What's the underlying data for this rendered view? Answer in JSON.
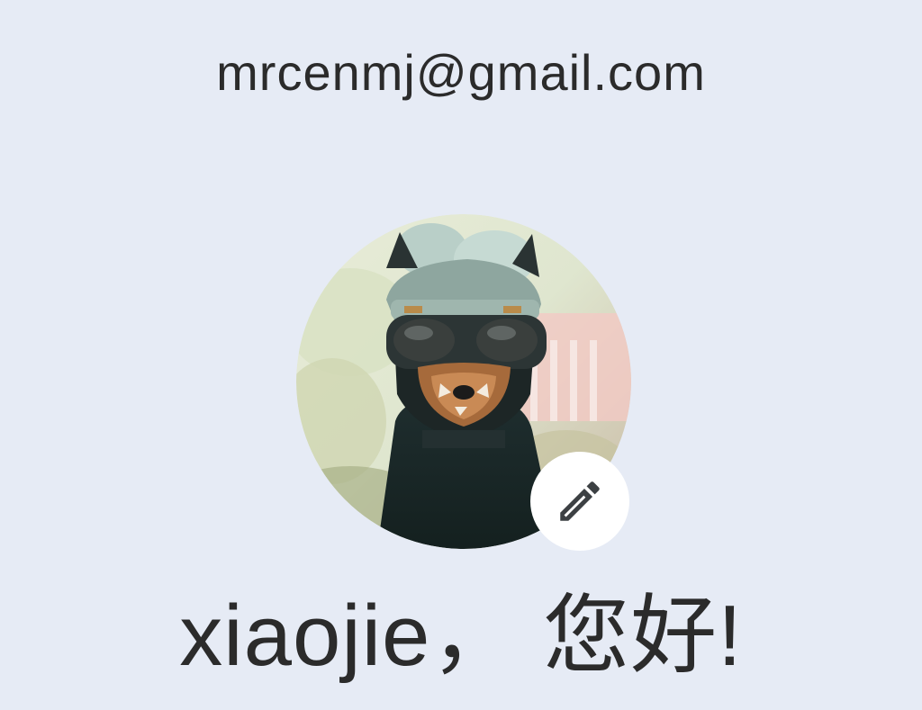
{
  "account": {
    "email": "mrcenmj@gmail.com",
    "greeting": "xiaojie，  您好!"
  },
  "avatar": {
    "icon": "avatar"
  },
  "edit": {
    "icon": "pencil-icon"
  },
  "colors": {
    "background": "#e6ebf5",
    "text": "#2b2b2b",
    "badge": "#ffffff"
  }
}
